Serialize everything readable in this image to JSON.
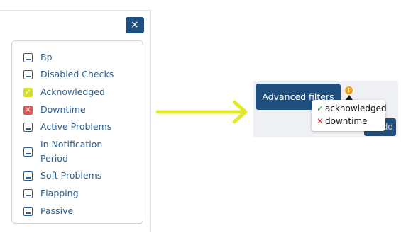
{
  "panel": {
    "close_label": "×",
    "filters": [
      {
        "label": "Bp",
        "state": "unchecked"
      },
      {
        "label": "Disabled Checks",
        "state": "unchecked"
      },
      {
        "label": "Acknowledged",
        "state": "checked"
      },
      {
        "label": "Downtime",
        "state": "excluded"
      },
      {
        "label": "Active Problems",
        "state": "unchecked"
      },
      {
        "label": "In Notification Period",
        "state": "unchecked"
      },
      {
        "label": "Soft Problems",
        "state": "unchecked"
      },
      {
        "label": "Flapping",
        "state": "unchecked"
      },
      {
        "label": "Passive",
        "state": "unchecked"
      }
    ]
  },
  "preview": {
    "advanced_filters_label": "Advanced filters",
    "info_badge": "i",
    "add_label": "+ Add",
    "tooltip": {
      "included": "acknowledged",
      "excluded": "downtime"
    }
  },
  "colors": {
    "primary": "#1f4f7f",
    "checked": "#d6de2c",
    "excluded": "#e05a5a",
    "arrow": "#e2e82a",
    "info": "#f0a020"
  }
}
